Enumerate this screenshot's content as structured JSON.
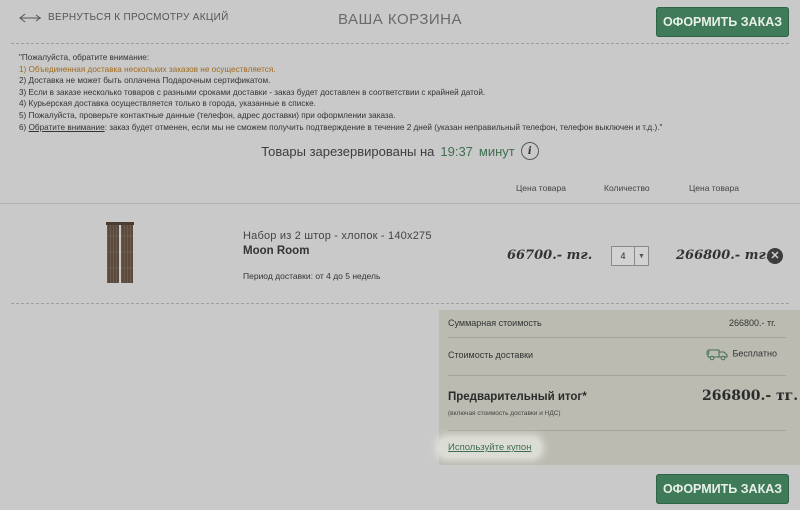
{
  "header": {
    "back_label": "ВЕРНУТЬСЯ К ПРОСМОТРУ АКЦИЙ",
    "title": "ВАША КОРЗИНА",
    "checkout_label": "ОФОРМИТЬ ЗАКАЗ"
  },
  "notice": {
    "intro": "\"Пожалуйста, обратите внимание:",
    "item1": "1) Объединенная доставка нескольких заказов не осуществляется.",
    "item2": "2) Доставка не может быть оплачена Подарочным сертификатом.",
    "item3": "3) Если в заказе несколько товаров с разными сроками доставки - заказ будет доставлен в соответствии с крайней датой.",
    "item4": "4) Курьерская доставка осуществляется только в города, указанные в списке.",
    "item5": "5) Пожалуйста, проверьте контактные данные (телефон, адрес доставки) при оформлении заказа.",
    "item6_prefix": "6) ",
    "item6_link": "Обратите внимание",
    "item6_rest": ": заказ будет отменен, если мы не сможем получить подтверждение в течение 2 дней (указан неправильный телефон, телефон выключен и т.д.).\""
  },
  "reserve": {
    "text": "Товары зарезервированы на",
    "time": "19:37",
    "unit": "минут"
  },
  "table": {
    "columns": [
      "Цена товара",
      "Количество",
      "Цена товара"
    ]
  },
  "item": {
    "name": "Набор из 2 штор - хлопок - 140x275",
    "brand": "Moon Room",
    "delivery_period": "Период доставки: от 4 до 5 недель",
    "unit_price": "66700.- тг.",
    "quantity": "4",
    "total_price": "266800.- тг."
  },
  "summary": {
    "subtotal_label": "Суммарная стоимость",
    "subtotal_value": "266800.- тг.",
    "delivery_label": "Стоимость доставки",
    "delivery_value": "Бесплатно",
    "total_label": "Предварительный итог*",
    "total_note": "(включая стоимость доставки и НДС)",
    "total_value": "266800.- тг.",
    "coupon_link": "Используйте купон"
  },
  "colors": {
    "accent": "#3f7b58",
    "background": "#c9c9c9",
    "summary_bg": "#bbbbb2"
  }
}
